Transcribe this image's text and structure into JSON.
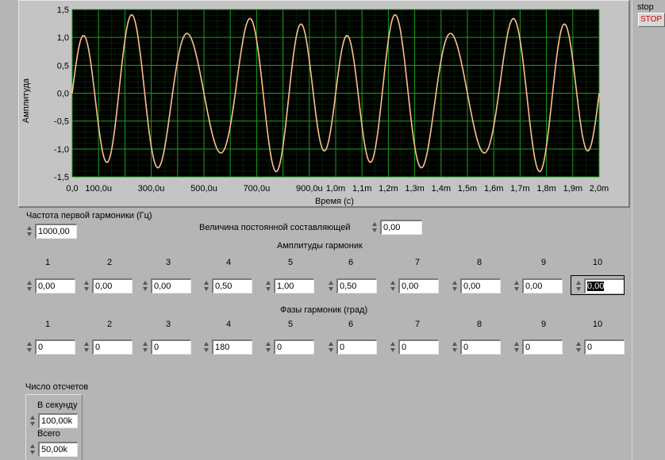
{
  "graph": {
    "y_label": "Амплитуда",
    "x_label": "Время (с)",
    "y_ticks": [
      "1,5",
      "1,0",
      "0,5",
      "0,0",
      "-0,5",
      "-1,0",
      "-1,5"
    ],
    "x_ticks": [
      "0,0",
      "100,0u",
      "300,0u",
      "500,0u",
      "700,0u",
      "900,0u",
      "1,0m",
      "1,1m",
      "1,2m",
      "1,3m",
      "1,4m",
      "1,5m",
      "1,6m",
      "1,7m",
      "1,8m",
      "1,9m",
      "2,0m"
    ],
    "plot_bg": "#000000",
    "grid_color": "#0d7a0d",
    "trace_color": "#ffbf8c"
  },
  "chart_data": {
    "type": "line",
    "title": "",
    "xlabel": "Время (с)",
    "ylabel": "Амплитуда",
    "xlim": [
      0,
      0.002
    ],
    "ylim": [
      -1.5,
      1.5
    ],
    "grid": true,
    "series": [
      {
        "formula": "0.5*sin(2π·4000t) + 1.0*sin(2π·5000t) + 0.5*sin(2π·6000t + 180°)",
        "samples_per_second": 100000,
        "x_start": 0,
        "x_end": 0.002
      }
    ]
  },
  "stop": {
    "caption": "stop",
    "button_label": "STOP"
  },
  "freq": {
    "label": "Частота первой гармоники (Гц)",
    "value": "1000,00"
  },
  "dc": {
    "label": "Величина постоянной составляющей",
    "value": "0,00"
  },
  "amps": {
    "title": "Амплитуды гармоник",
    "headers": [
      "1",
      "2",
      "3",
      "4",
      "5",
      "6",
      "7",
      "8",
      "9",
      "10"
    ],
    "values": [
      "0,00",
      "0,00",
      "0,00",
      "0,50",
      "1,00",
      "0,50",
      "0,00",
      "0,00",
      "0,00",
      "0,00"
    ]
  },
  "phases": {
    "title": "Фазы гармоник (град)",
    "headers": [
      "1",
      "2",
      "3",
      "4",
      "5",
      "6",
      "7",
      "8",
      "9",
      "10"
    ],
    "values": [
      "0",
      "0",
      "0",
      "180",
      "0",
      "0",
      "0",
      "0",
      "0",
      "0"
    ]
  },
  "samples": {
    "title": "Число отсчетов",
    "per_second_label": "В секунду",
    "per_second_value": "100,00k",
    "total_label": "Всего",
    "total_value": "50,00k"
  }
}
